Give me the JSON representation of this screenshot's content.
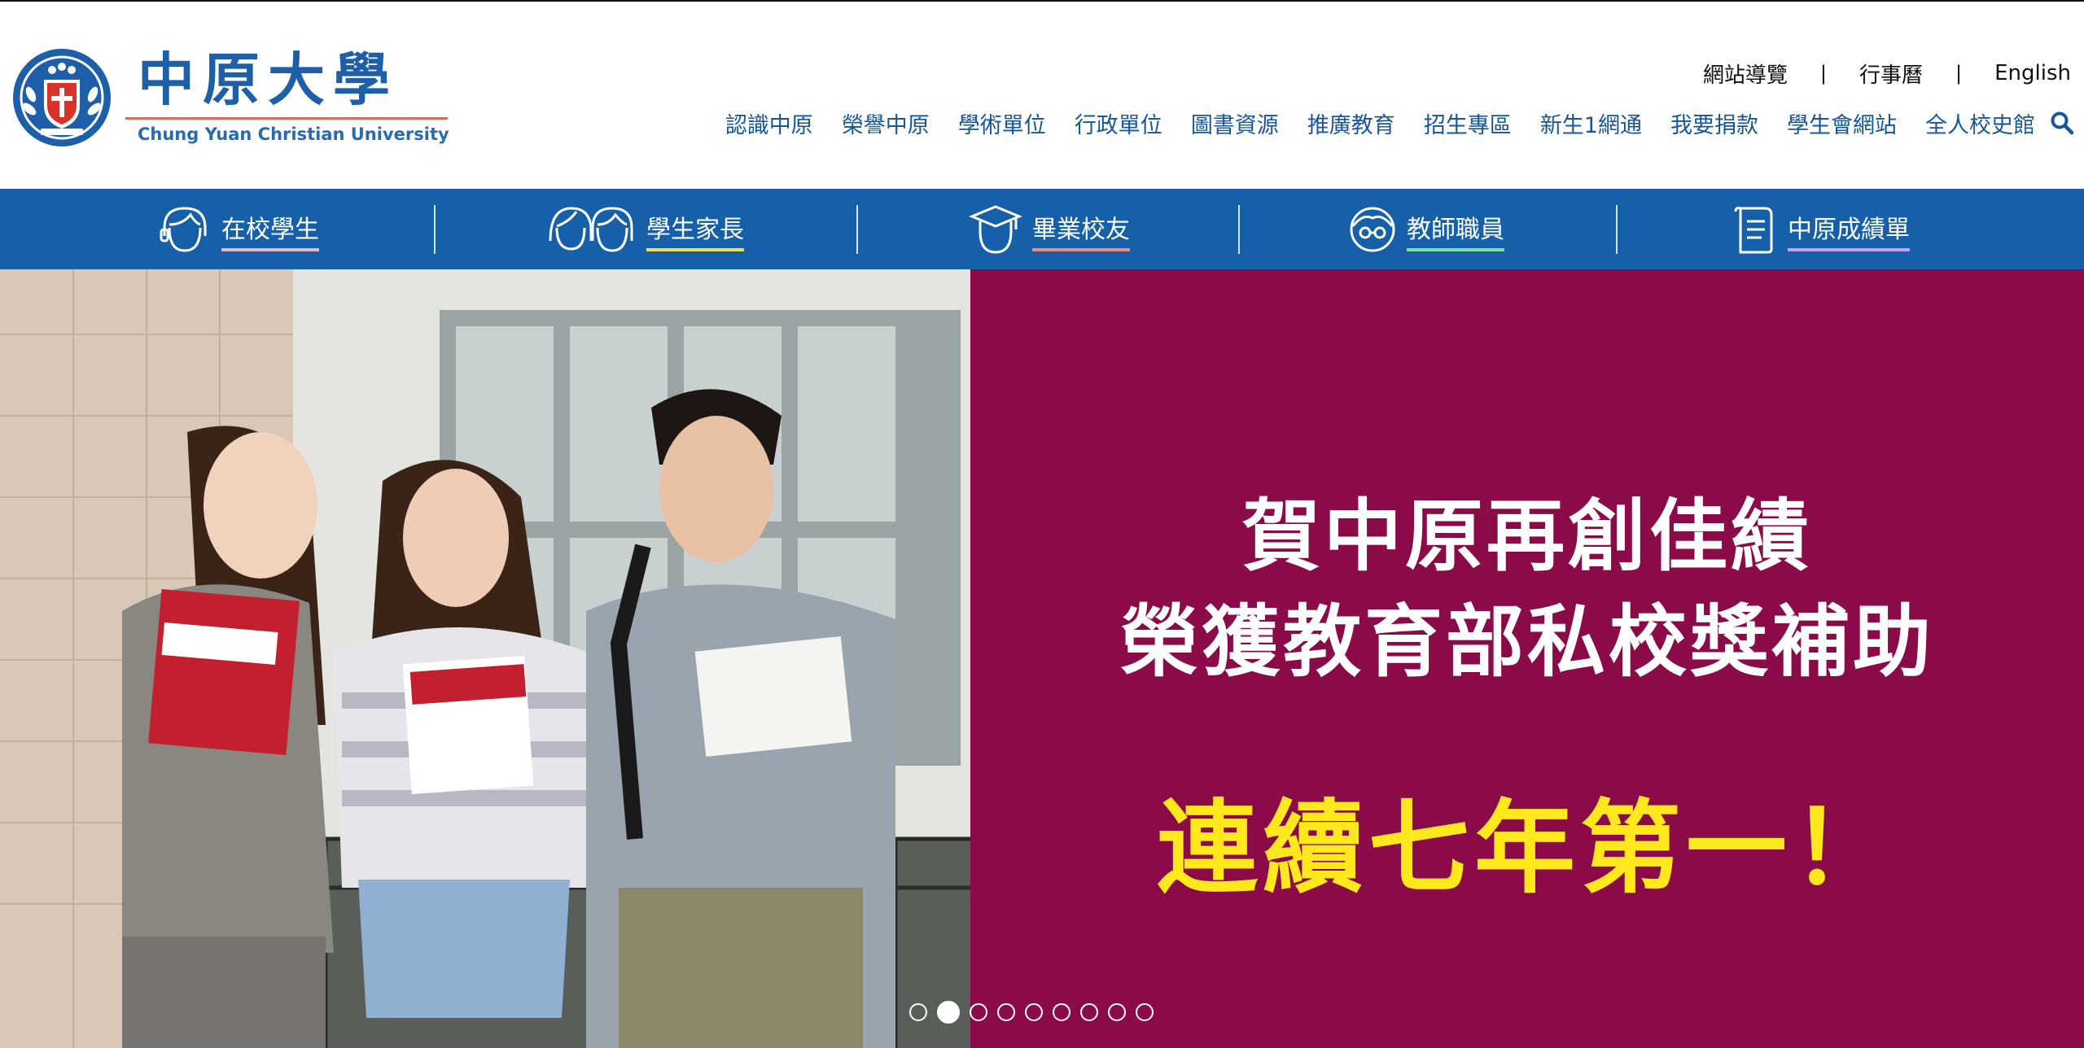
{
  "header": {
    "logo_cn": "中原大學",
    "logo_en": "Chung Yuan Christian University",
    "utility_links": [
      "網站導覽",
      "行事曆",
      "English"
    ],
    "utility_sep": "|",
    "nav": [
      "認識中原",
      "榮譽中原",
      "學術單位",
      "行政單位",
      "圖書資源",
      "推廣教育",
      "招生專區",
      "新生1網通",
      "我要捐款",
      "學生會網站",
      "全人校史館"
    ]
  },
  "audience": [
    {
      "label": "在校學生",
      "icon": "student-face-icon",
      "underline": "#e8b8c8"
    },
    {
      "label": "學生家長",
      "icon": "parents-icon",
      "underline": "#f0e04a"
    },
    {
      "label": "畢業校友",
      "icon": "graduate-cap-icon",
      "underline": "#f08a7a"
    },
    {
      "label": "教師職員",
      "icon": "teacher-glasses-icon",
      "underline": "#7ee0a0"
    },
    {
      "label": "中原成績單",
      "icon": "document-icon",
      "underline": "#c9a0f0"
    }
  ],
  "hero": {
    "line1": "賀中原再創佳績",
    "line2": "榮獲教育部私校獎補助",
    "line3": "連續七年第一！",
    "slide_count": 9,
    "active_slide": 2,
    "colors": {
      "banner": "#8b0a48",
      "highlight": "#ffe81e"
    }
  }
}
